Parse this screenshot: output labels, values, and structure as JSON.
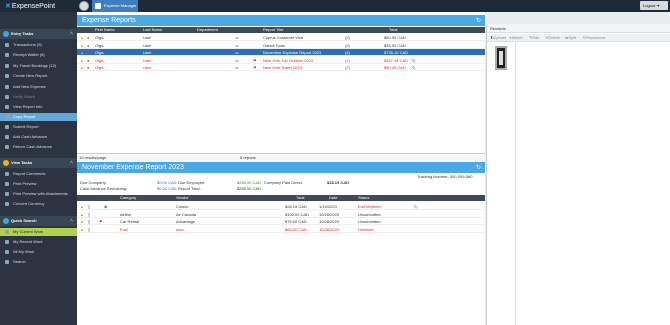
{
  "app": {
    "brand": "ExpensePoint",
    "tab": "Expense Manager",
    "logout": "Logout"
  },
  "sidebar": {
    "sections": [
      {
        "label": "Entry Tasks"
      },
      {
        "label": "View Tasks"
      },
      {
        "label": "Quick Search"
      }
    ],
    "entry_items": [
      "Transactions (9)",
      "Receipt Wallet (6)",
      "My Travel Bookings (12)",
      "Create New Report",
      "Add New Expense",
      "Verify Match",
      "View Report Info",
      "Copy Report",
      "Submit Report",
      "Add Cash Advance",
      "Return Cash Advance"
    ],
    "view_items": [
      "Report Comments",
      "Print Preview",
      "Print Preview with Attachments",
      "Convert Currency"
    ],
    "search_items": [
      "My Current Work",
      "My Recent Work",
      "All My Work",
      "Search"
    ]
  },
  "reports": {
    "title": "Expense Reports",
    "headers": [
      "First Name",
      "Last Name",
      "Department",
      "Report Title",
      "Total"
    ],
    "rows": [
      {
        "first": "Olga",
        "last": "User",
        "dept": "",
        "title": "Cyprus Customer Visit",
        "count": "(2)",
        "total": "$80.00 CAD",
        "red": false
      },
      {
        "first": "Olga",
        "last": "User",
        "dept": "",
        "title": "Gabidi Tools",
        "count": "(2)",
        "total": "$45.00 CAD",
        "red": false
      },
      {
        "first": "Olga",
        "last": "User",
        "dept": "",
        "title": "November Expense Report 2023",
        "count": "(4)",
        "total": "$735.15 CAD",
        "red": false
      },
      {
        "first": "Olga",
        "last": "User",
        "dept": "",
        "title": "New York Trip October 2023",
        "count": "(2)",
        "total": "$457.44 CAD",
        "red": true
      },
      {
        "first": "Olga",
        "last": "User",
        "dept": "",
        "title": "New York Travel 2023",
        "count": "(2)",
        "total": "$80.49 CAD",
        "red": true
      }
    ],
    "per_page": "10 results/page",
    "count_text": "5 reports"
  },
  "detail": {
    "title": "November Expense Report 2023",
    "tracking": "Tracking Number: 000-009-560",
    "due_company_label": "Due Company:",
    "due_company": "$0.00 CAD",
    "due_employee_label": "Due Employee:",
    "due_employee": "$255.00 CAD",
    "company_paid_label": "Company Paid Direct:",
    "company_paid": "$28.15 CAD",
    "cash_adv_label": "Cash Advance Remaining:",
    "cash_adv": "$0.00 CAD",
    "report_total_label": "Report Total:",
    "report_total": "$255.00 CAD",
    "headers": [
      "Category",
      "Vendor",
      "Total",
      "Date",
      "Status"
    ],
    "rows": [
      {
        "category": "",
        "vendor": "Costco",
        "total": "$28.15 CAD",
        "date": "1/15/2023",
        "status": "Edit required",
        "red": false
      },
      {
        "category": "Airline",
        "vendor": "Air Canada",
        "total": "$100.00 CAD",
        "date": "10/28/2023",
        "status": "Unsubmitted",
        "red": false
      },
      {
        "category": "Car Rental",
        "vendor": "Advantage",
        "total": "$75.00 CAD",
        "date": "10/28/2023",
        "status": "Unsubmitted",
        "red": false
      },
      {
        "category": "Fuel",
        "vendor": "esso",
        "total": "$65.00 CAD",
        "date": "10/28/2023",
        "status": "Declined",
        "red": true
      }
    ]
  },
  "receipts": {
    "title": "Receipts",
    "toolbar": [
      "Upload",
      "Attach",
      "Edit",
      "Delete",
      "Split",
      "Reprocess"
    ]
  },
  "colors": {
    "accent": "#4aa8e4",
    "selected": "#2f6fb5",
    "sidebar": "#2b3440"
  }
}
